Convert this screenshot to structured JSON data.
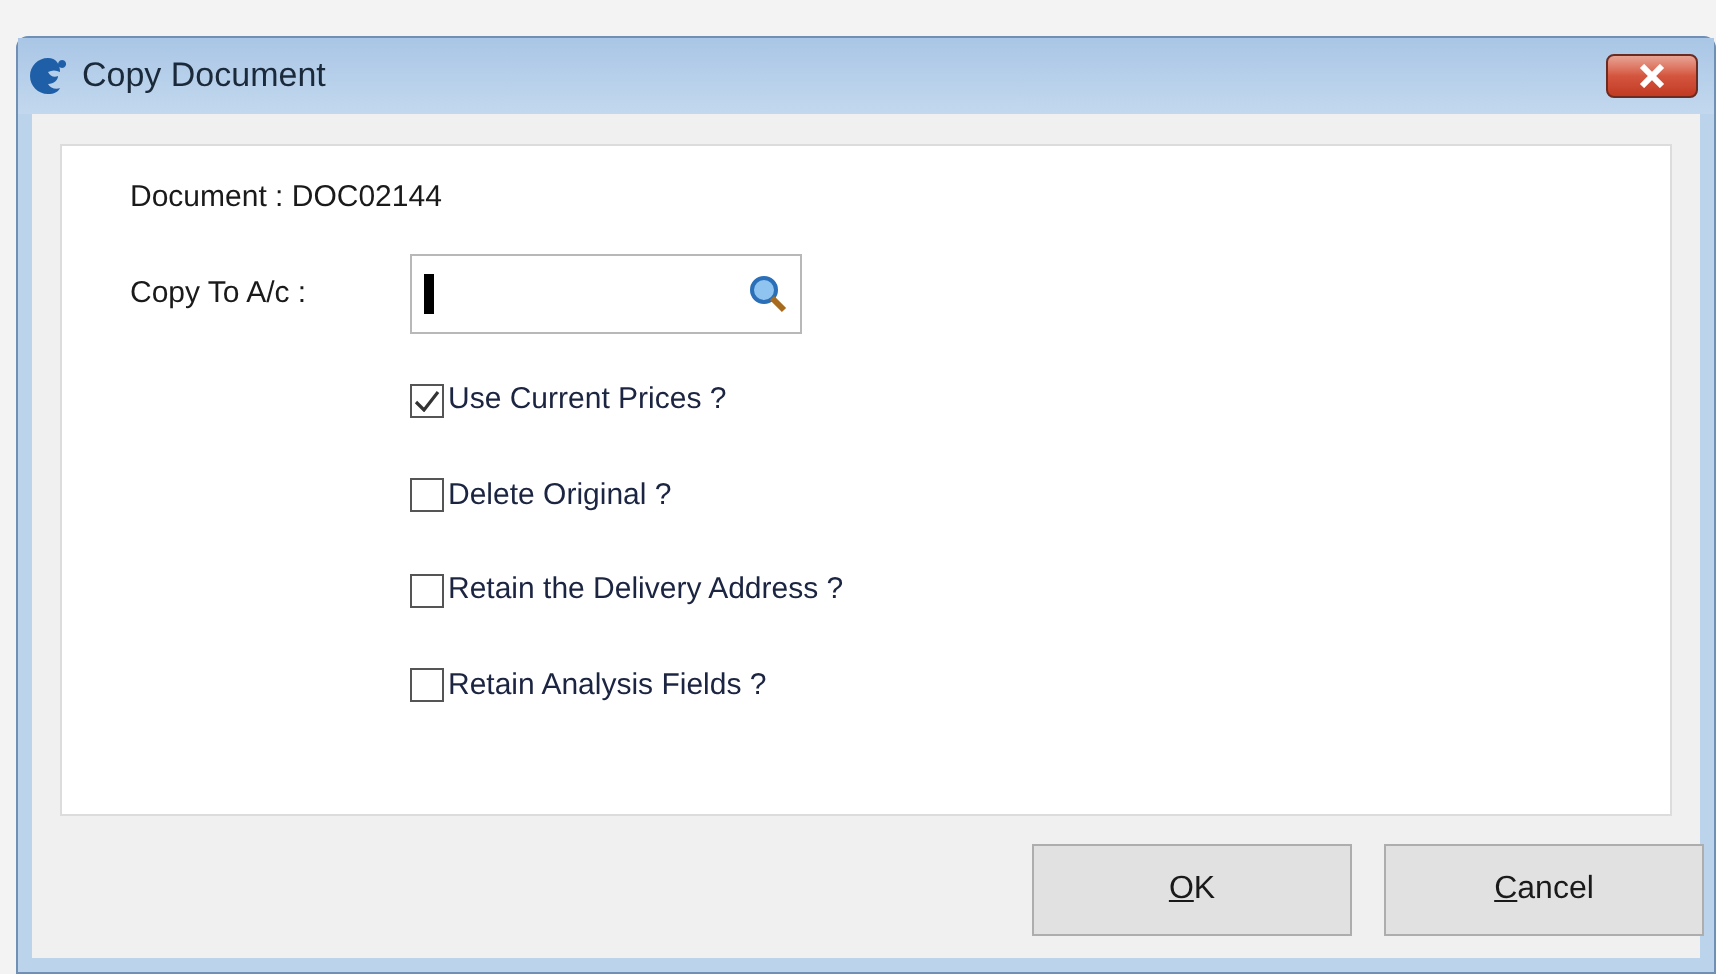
{
  "window": {
    "title": "Copy Document"
  },
  "document_line": "Document : DOC02144",
  "copy_to": {
    "label": "Copy To A/c :"
  },
  "options": [
    {
      "label": "Use Current Prices ?",
      "checked": true
    },
    {
      "label": "Delete Original ?",
      "checked": false
    },
    {
      "label": "Retain the Delivery Address ?",
      "checked": false
    },
    {
      "label": "Retain Analysis Fields ?",
      "checked": false
    }
  ],
  "buttons": [
    {
      "label": "OK",
      "access_key_underlined": true
    },
    {
      "label": "Cancel",
      "access_key_underlined": true
    }
  ]
}
